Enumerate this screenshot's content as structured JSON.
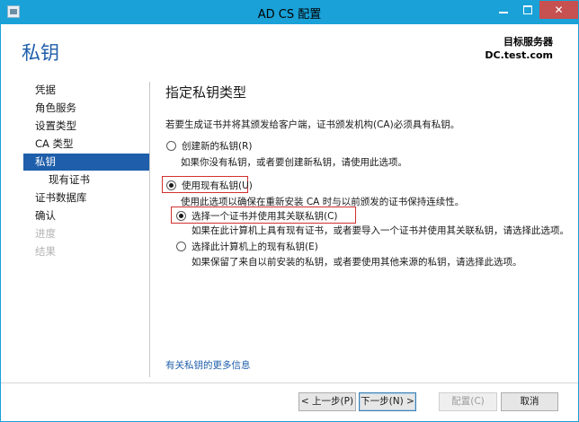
{
  "window": {
    "title": "AD CS 配置"
  },
  "header": {
    "page_title": "私钥",
    "target_label": "目标服务器",
    "target_name": "DC.test.com"
  },
  "sidebar": {
    "items": [
      {
        "label": "凭据",
        "state": "normal"
      },
      {
        "label": "角色服务",
        "state": "normal"
      },
      {
        "label": "设置类型",
        "state": "normal"
      },
      {
        "label": "CA 类型",
        "state": "normal"
      },
      {
        "label": "私钥",
        "state": "active"
      },
      {
        "label": "现有证书",
        "state": "sub"
      },
      {
        "label": "证书数据库",
        "state": "normal"
      },
      {
        "label": "确认",
        "state": "normal"
      },
      {
        "label": "进度",
        "state": "disabled"
      },
      {
        "label": "结果",
        "state": "disabled"
      }
    ]
  },
  "main": {
    "heading": "指定私钥类型",
    "intro": "若要生成证书并将其颁发给客户端，证书颁发机构(CA)必须具有私钥。",
    "option_new": {
      "label": "创建新的私钥(R)",
      "description": "如果你没有私钥，或者要创建新私钥，请使用此选项。",
      "checked": false
    },
    "option_existing": {
      "label": "使用现有私钥(U)",
      "description": "使用此选项以确保在重新安装 CA 时与以前颁发的证书保持连续性。",
      "checked": true
    },
    "sub_option_cert": {
      "label": "选择一个证书并使用其关联私钥(C)",
      "description": "如果在此计算机上具有现有证书，或者要导入一个证书并使用其关联私钥，请选择此选项。",
      "checked": true
    },
    "sub_option_existing_key": {
      "label": "选择此计算机上的现有私钥(E)",
      "description": "如果保留了来自以前安装的私钥，或者要使用其他来源的私钥，请选择此选项。",
      "checked": false
    },
    "more_info_link": "有关私钥的更多信息"
  },
  "footer": {
    "prev_label": "< 上一步(P)",
    "next_label": "下一步(N) >",
    "configure_label": "配置(C)",
    "cancel_label": "取消"
  },
  "colors": {
    "titlebar": "#19a1d8",
    "accent": "#1e5eaa",
    "highlight": "#d32f2f"
  }
}
